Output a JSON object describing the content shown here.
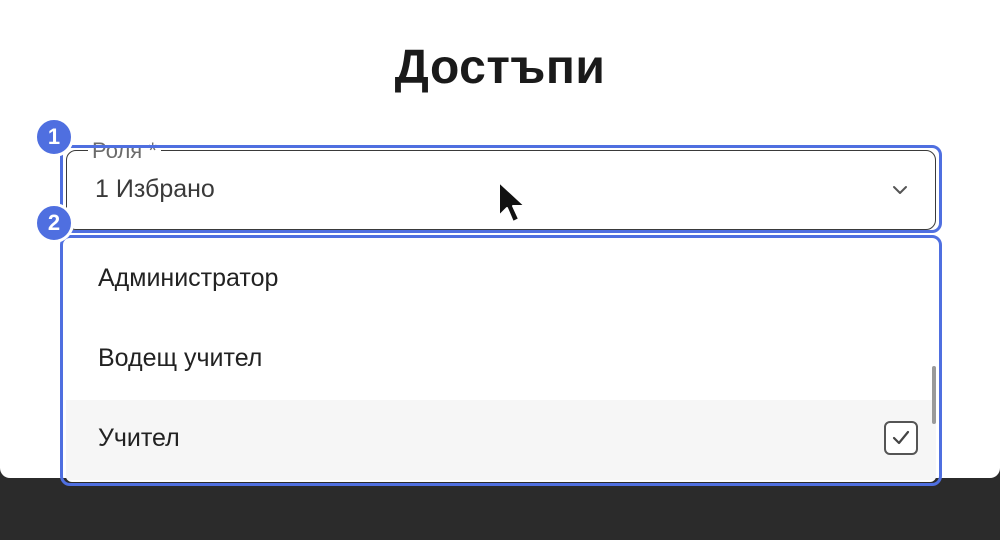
{
  "dialog": {
    "title": "Достъпи"
  },
  "role_field": {
    "label": "Роля *",
    "value": "1 Избрано",
    "icon": "chevron-down-icon"
  },
  "dropdown": {
    "options": [
      {
        "label": "Администратор",
        "checked": false
      },
      {
        "label": "Водещ учител",
        "checked": false
      },
      {
        "label": "Учител",
        "checked": true
      }
    ]
  },
  "annotations": {
    "badge_1": "1",
    "badge_2": "2",
    "highlight_color": "#4f6fe0"
  }
}
